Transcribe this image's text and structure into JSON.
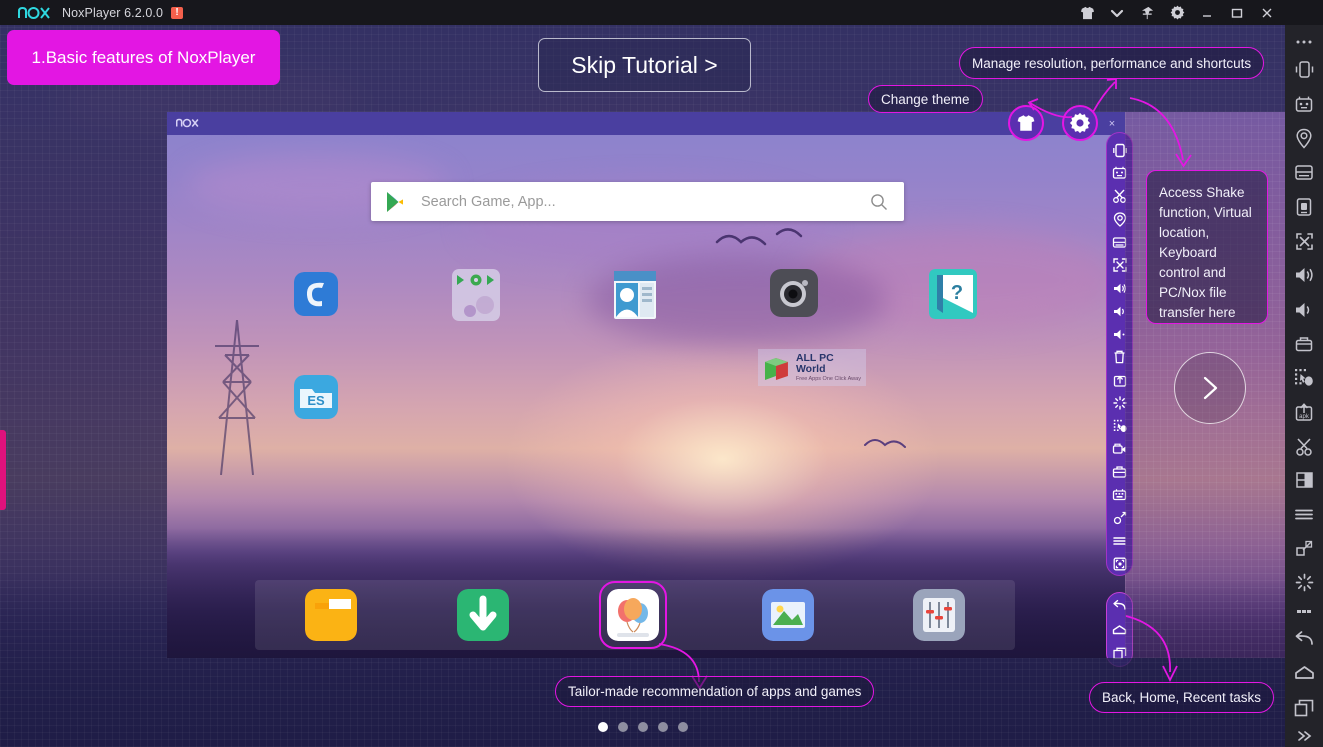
{
  "window": {
    "app_name": "NoxPlayer 6.2.0.0",
    "alert_badge": "!",
    "logo_text": "nox",
    "controls": [
      {
        "name": "theme-tshirt-icon",
        "label": "Change theme"
      },
      {
        "name": "chevron-down-icon",
        "label": "More"
      },
      {
        "name": "pin-icon",
        "label": "Always on top"
      },
      {
        "name": "gear-icon",
        "label": "Settings"
      },
      {
        "name": "minimize-icon",
        "label": "Minimize"
      },
      {
        "name": "maximize-icon",
        "label": "Maximize"
      },
      {
        "name": "close-icon",
        "label": "Close"
      }
    ]
  },
  "tutorial": {
    "step_badge": "1.Basic features of NoxPlayer",
    "skip_button": "Skip Tutorial >",
    "next_button_icon": "chevron-right-icon",
    "callouts": {
      "change_theme": "Change theme",
      "manage": "Manage resolution, performance and shortcuts",
      "sidebar_tools": "Access Shake function, Virtual location, Keyboard control and PC/Nox file transfer here",
      "recommendation": "Tailor-made recommendation of apps and games",
      "navigation": "Back, Home, Recent tasks"
    },
    "pager": {
      "total": 5,
      "current": 1
    }
  },
  "emulator": {
    "title": "nox",
    "window_controls": [
      "pin-icon",
      "minimize-icon",
      "close-icon"
    ],
    "search": {
      "placeholder": "Search Game, App...",
      "value": "",
      "leading_icon": "google-play-icon",
      "trailing_icon": "search-icon"
    },
    "watermark": {
      "title": "ALL PC World",
      "subtitle": "Free Apps One Click Away"
    },
    "desktop_apps": [
      {
        "name": "app-icon-chrome",
        "label": "Browser"
      },
      {
        "name": "app-icon-folder-google",
        "label": "Google"
      },
      {
        "name": "app-icon-contacts",
        "label": "Contacts"
      },
      {
        "name": "app-icon-camera",
        "label": "Camera"
      },
      {
        "name": "app-icon-help",
        "label": "Help"
      },
      {
        "name": "app-icon-es-explorer",
        "label": "ES File Explorer"
      }
    ],
    "dock_apps": [
      {
        "name": "dock-icon-files",
        "label": "Files"
      },
      {
        "name": "dock-icon-downloads",
        "label": "Downloads"
      },
      {
        "name": "dock-icon-appstore",
        "label": "App Store"
      },
      {
        "name": "dock-icon-gallery",
        "label": "Gallery"
      },
      {
        "name": "dock-icon-settings-mixer",
        "label": "Tools"
      }
    ],
    "sidebar_tools": [
      {
        "name": "shake-icon",
        "label": "Shake"
      },
      {
        "name": "keyboard-control-icon",
        "label": "Keyboard control"
      },
      {
        "name": "scissors-icon",
        "label": "Screenshot crop"
      },
      {
        "name": "virtual-location-icon",
        "label": "Virtual location"
      },
      {
        "name": "multi-window-icon",
        "label": "Multi window"
      },
      {
        "name": "fullscreen-icon",
        "label": "Fullscreen"
      },
      {
        "name": "volume-up-icon",
        "label": "Volume up"
      },
      {
        "name": "volume-mid-icon",
        "label": "Volume"
      },
      {
        "name": "volume-mute-icon",
        "label": "Mute"
      },
      {
        "name": "trash-icon",
        "label": "Clear"
      },
      {
        "name": "install-apk-icon",
        "label": "Install APK"
      },
      {
        "name": "shake-burst-icon",
        "label": "Shake it"
      },
      {
        "name": "macro-record-icon",
        "label": "Macro recorder"
      },
      {
        "name": "video-record-icon",
        "label": "Screen record"
      },
      {
        "name": "toolbox-icon",
        "label": "Toolbox"
      },
      {
        "name": "keymapping-icon",
        "label": "Key mapping"
      },
      {
        "name": "rotate-icon",
        "label": "Rotate"
      },
      {
        "name": "menu-icon",
        "label": "Menu"
      },
      {
        "name": "fullscreen-box-icon",
        "label": "Full screen"
      }
    ],
    "nav_buttons": [
      {
        "name": "back-icon",
        "label": "Back"
      },
      {
        "name": "home-icon",
        "label": "Home"
      },
      {
        "name": "recent-tasks-icon",
        "label": "Recent tasks"
      }
    ]
  },
  "rail": {
    "items": [
      {
        "name": "more-dots-icon",
        "label": "More"
      },
      {
        "name": "shake-icon",
        "label": "Shake"
      },
      {
        "name": "keyboard-control-icon",
        "label": "Keyboard control"
      },
      {
        "name": "virtual-location-icon",
        "label": "Virtual location"
      },
      {
        "name": "multi-window-icon",
        "label": "Multi window"
      },
      {
        "name": "file-transfer-icon",
        "label": "File transfer"
      },
      {
        "name": "fullscreen-icon",
        "label": "Fullscreen"
      },
      {
        "name": "volume-up-icon",
        "label": "Volume up"
      },
      {
        "name": "volume-down-icon",
        "label": "Volume down"
      },
      {
        "name": "video-record-icon",
        "label": "Screen record"
      },
      {
        "name": "macro-record-icon",
        "label": "Macro recorder"
      },
      {
        "name": "install-apk-icon",
        "label": "Install APK"
      },
      {
        "name": "scissors-icon",
        "label": "Screenshot"
      },
      {
        "name": "layout-icon",
        "label": "Layout"
      },
      {
        "name": "menu-icon",
        "label": "Menu"
      },
      {
        "name": "resize-icon",
        "label": "Resize"
      },
      {
        "name": "shake-burst-icon",
        "label": "Shake it"
      },
      {
        "name": "back-icon",
        "label": "Back"
      },
      {
        "name": "home-icon",
        "label": "Home"
      },
      {
        "name": "recent-tasks-icon",
        "label": "Recent tasks"
      },
      {
        "name": "collapse-icon",
        "label": "Collapse"
      }
    ]
  },
  "colors": {
    "accent_magenta": "#e316e3",
    "titlebar_bg": "#17171c",
    "rail_bg": "#232329",
    "sidebar_purple": "#5b2fb0",
    "overlay_dim": "#20204a"
  }
}
